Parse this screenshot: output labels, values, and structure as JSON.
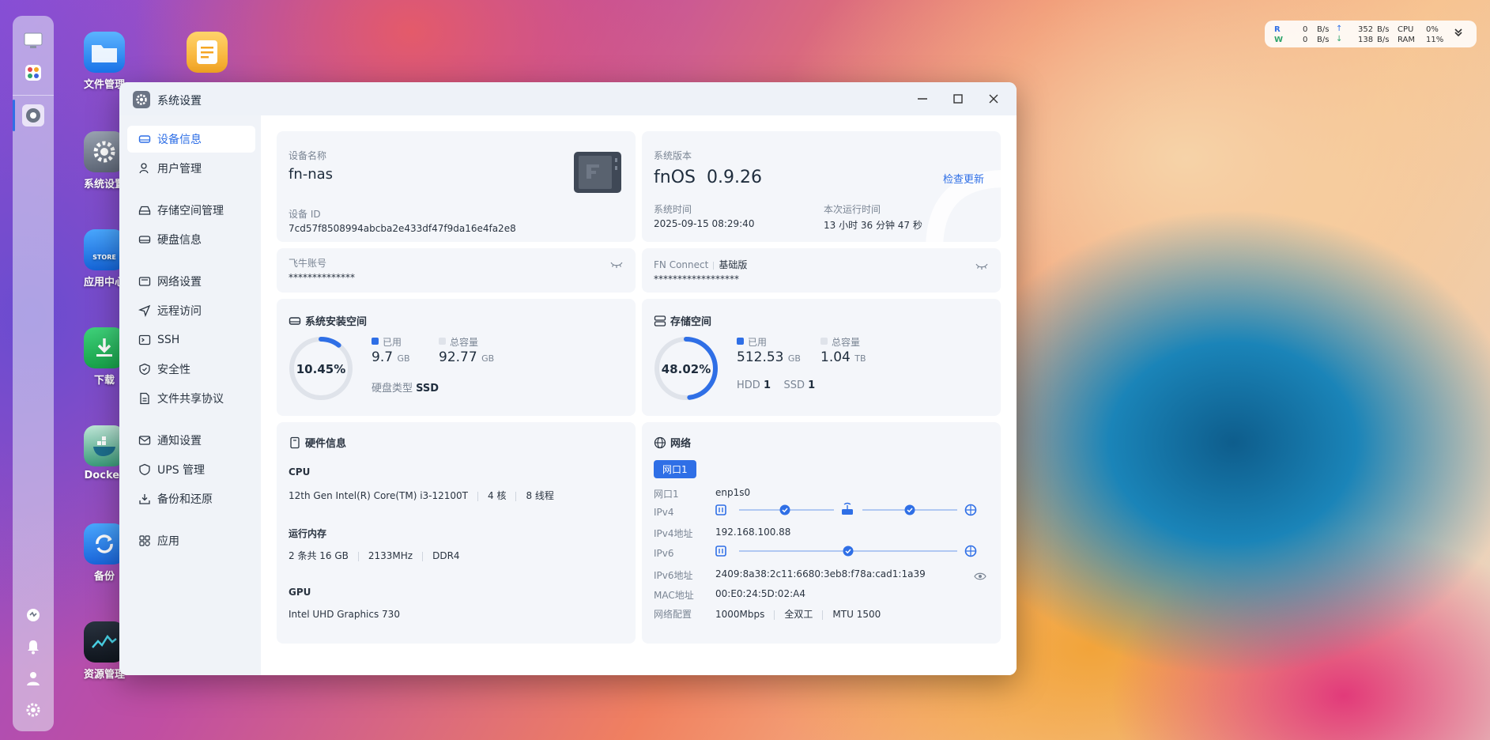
{
  "colors": {
    "accent": "#2f6fe6",
    "ring_track": "#dfe3ea"
  },
  "desktop": {
    "icons": [
      {
        "label": "文件管理",
        "icon": "folder-icon"
      },
      {
        "label": "",
        "icon": "notepad-icon"
      },
      {
        "label": "系统设置",
        "icon": "gear-icon"
      },
      {
        "label": "应用中心",
        "icon": "store-icon"
      },
      {
        "label": "下载",
        "icon": "download-icon"
      },
      {
        "label": "Docker",
        "icon": "docker-icon"
      },
      {
        "label": "备份",
        "icon": "backup-icon"
      },
      {
        "label": "资源管理",
        "icon": "resource-icon"
      }
    ],
    "store_text": "STORE"
  },
  "monitor": {
    "r_label": "R",
    "w_label": "W",
    "r_val": "0",
    "w_val": "0",
    "unit": "B/s",
    "up_val": "352",
    "down_val": "138",
    "cpu_label": "CPU",
    "ram_label": "RAM",
    "cpu_val": "0%",
    "ram_val": "11%"
  },
  "window": {
    "title": "系统设置"
  },
  "sidebar": {
    "items": [
      {
        "label": "设备信息",
        "icon": "device-icon"
      },
      {
        "label": "用户管理",
        "icon": "user-icon"
      },
      {
        "label": "存储空间管理",
        "icon": "storage-icon"
      },
      {
        "label": "硬盘信息",
        "icon": "disk-icon"
      },
      {
        "label": "网络设置",
        "icon": "network-icon"
      },
      {
        "label": "远程访问",
        "icon": "send-icon"
      },
      {
        "label": "SSH",
        "icon": "terminal-icon"
      },
      {
        "label": "安全性",
        "icon": "shield-icon"
      },
      {
        "label": "文件共享协议",
        "icon": "file-icon"
      },
      {
        "label": "通知设置",
        "icon": "mail-icon"
      },
      {
        "label": "UPS 管理",
        "icon": "ups-icon"
      },
      {
        "label": "备份和还原",
        "icon": "backup-restore-icon"
      },
      {
        "label": "应用",
        "icon": "apps-icon"
      }
    ]
  },
  "device": {
    "name_label": "设备名称",
    "name": "fn-nas",
    "id_label": "设备 ID",
    "id": "7cd57f8508994abcba2e433df47f9da16e4fa2e8"
  },
  "system": {
    "version_label": "系统版本",
    "os": "fnOS",
    "version": "0.9.26",
    "check_update": "检查更新",
    "time_label": "系统时间",
    "time": "2025-09-15 08:29:40",
    "uptime_label": "本次运行时间",
    "uptime": "13 小时 36 分钟 47 秒"
  },
  "account": {
    "label": "飞牛账号",
    "value": "**************"
  },
  "connect": {
    "label": "FN Connect",
    "edition": "基础版",
    "value": "******************"
  },
  "sys_space": {
    "title": "系统安装空间",
    "percent_text": "10.45%",
    "percent": 10.45,
    "used_label": "已用",
    "used": "9.7",
    "used_unit": "GB",
    "total_label": "总容量",
    "total": "92.77",
    "total_unit": "GB",
    "disk_type_label": "硬盘类型",
    "disk_type": "SSD"
  },
  "storage": {
    "title": "存储空间",
    "percent_text": "48.02%",
    "percent": 48.02,
    "used_label": "已用",
    "used": "512.53",
    "used_unit": "GB",
    "total_label": "总容量",
    "total": "1.04",
    "total_unit": "TB",
    "hdd_label": "HDD",
    "hdd": "1",
    "ssd_label": "SSD",
    "ssd": "1"
  },
  "hardware": {
    "title": "硬件信息",
    "cpu_label": "CPU",
    "cpu_model": "12th Gen Intel(R) Core(TM) i3-12100T",
    "cpu_cores": "4 核",
    "cpu_threads": "8 线程",
    "mem_label": "运行内存",
    "mem_size": "2 条共 16 GB",
    "mem_freq": "2133MHz",
    "mem_type": "DDR4",
    "gpu_label": "GPU",
    "gpu": "Intel UHD Graphics 730"
  },
  "network": {
    "title": "网络",
    "tab": "网口1",
    "port_label": "网口1",
    "port": "enp1s0",
    "ipv4_label": "IPv4",
    "ipv4_addr_label": "IPv4地址",
    "ipv4_addr": "192.168.100.88",
    "ipv6_label": "IPv6",
    "ipv6_addr_label": "IPv6地址",
    "ipv6_addr": "2409:8a38:2c11:6680:3eb8:f78a:cad1:1a39",
    "mac_label": "MAC地址",
    "mac": "00:E0:24:5D:02:A4",
    "config_label": "网络配置",
    "speed": "1000Mbps",
    "duplex": "全双工",
    "mtu": "MTU 1500"
  }
}
